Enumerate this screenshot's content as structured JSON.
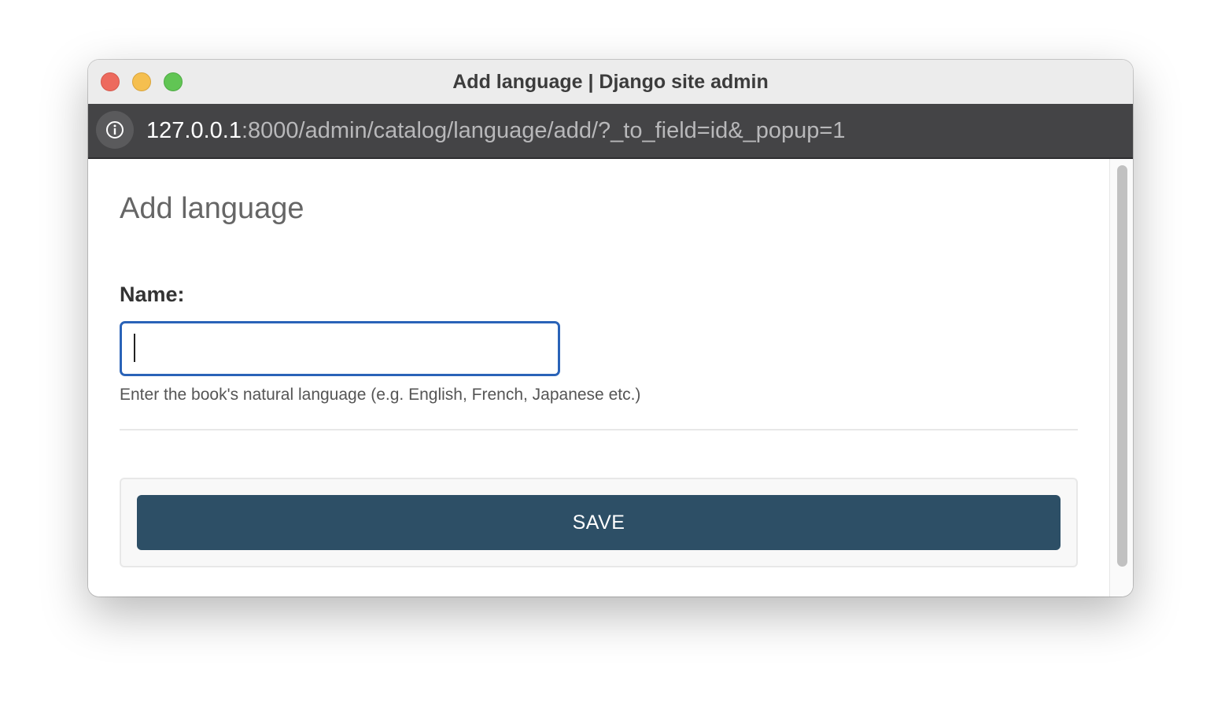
{
  "window": {
    "title": "Add language | Django site admin"
  },
  "address_bar": {
    "host": "127.0.0.1",
    "path": ":8000/admin/catalog/language/add/?_to_field=id&_popup=1",
    "icon": "info-icon"
  },
  "page": {
    "title": "Add language"
  },
  "form": {
    "name_label": "Name:",
    "name_value": "",
    "name_placeholder": "",
    "help_text": "Enter the book's natural language (e.g. English, French, Japanese etc.)",
    "save_label": "SAVE"
  },
  "colors": {
    "save_button": "#2d4f66",
    "input_focus_border": "#2a63b8",
    "close": "#ed6a5e",
    "minimize": "#f5bf4f",
    "maximize": "#61c554"
  }
}
